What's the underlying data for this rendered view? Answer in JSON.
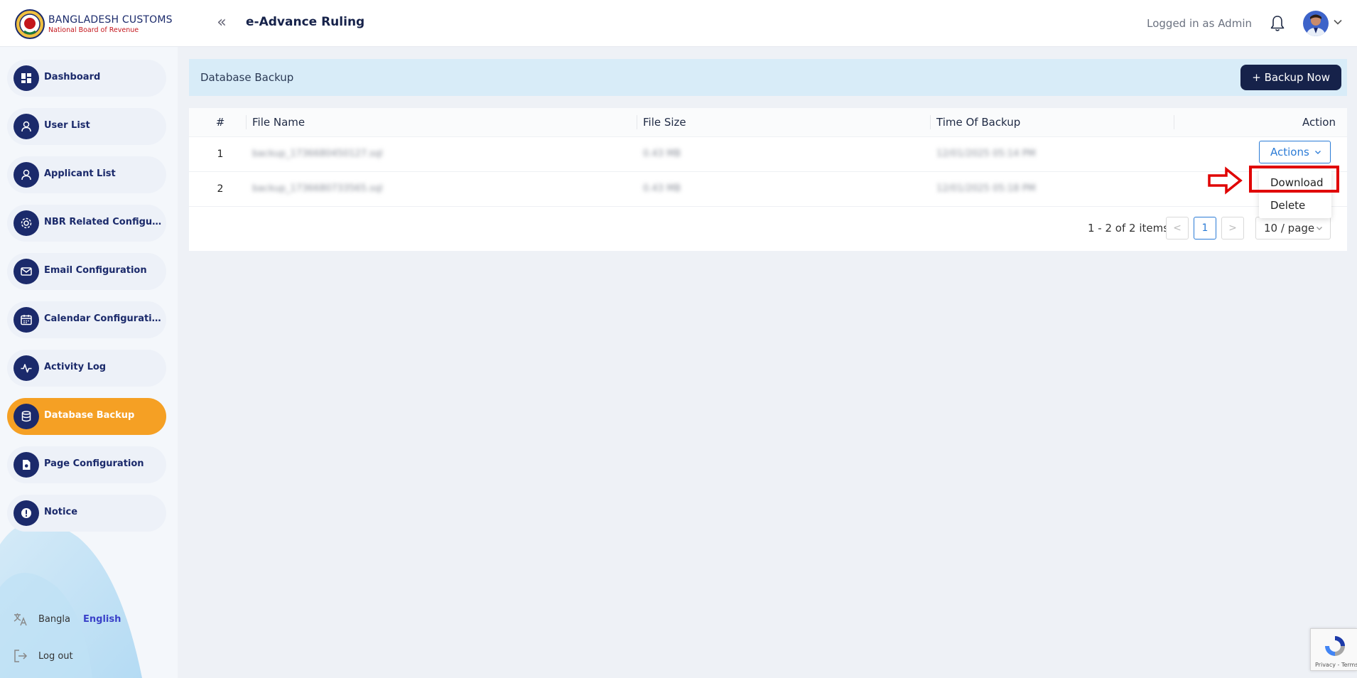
{
  "brand": {
    "title": "BANGLADESH CUSTOMS",
    "subtitle": "National Board of Revenue"
  },
  "header": {
    "app_title": "e-Advance Ruling",
    "logged_in_text": "Logged in as Admin",
    "collapse_icon": "double-chevron-left-icon"
  },
  "sidebar": {
    "items": [
      {
        "label": "Dashboard",
        "icon": "dashboard-icon",
        "active": false
      },
      {
        "label": "User List",
        "icon": "users-icon",
        "active": false
      },
      {
        "label": "Applicant List",
        "icon": "users-icon",
        "active": false
      },
      {
        "label": "NBR Related Configuration",
        "icon": "settings-icon",
        "active": false
      },
      {
        "label": "Email Configuration",
        "icon": "mail-icon",
        "active": false
      },
      {
        "label": "Calendar Configuration",
        "icon": "calendar-icon",
        "active": false
      },
      {
        "label": "Activity Log",
        "icon": "activity-icon",
        "active": false
      },
      {
        "label": "Database Backup",
        "icon": "database-icon",
        "active": true
      },
      {
        "label": "Page Configuration",
        "icon": "file-settings-icon",
        "active": false
      },
      {
        "label": "Notice",
        "icon": "alert-icon",
        "active": false
      }
    ],
    "lang_bangla": "Bangla",
    "lang_english": "English",
    "logout": "Log out"
  },
  "page": {
    "title": "Database Backup",
    "backup_button": "+ Backup Now"
  },
  "table": {
    "headers": [
      "#",
      "File Name",
      "File Size",
      "Time Of Backup",
      "Action"
    ],
    "rows": [
      {
        "index": "1",
        "file_name": "backup_1736680450127.sql",
        "file_size": "0.43 MB",
        "time": "12/01/2025 05:14 PM"
      },
      {
        "index": "2",
        "file_name": "backup_1736680733565.sql",
        "file_size": "0.43 MB",
        "time": "12/01/2025 05:18 PM"
      }
    ],
    "actions_label": "Actions"
  },
  "dropdown": {
    "items": [
      "Download",
      "Delete"
    ]
  },
  "pagination": {
    "summary": "1 - 2 of 2 items",
    "current_page": "1",
    "page_size": "10 / page",
    "prev": "<",
    "next": ">"
  },
  "recaptcha": {
    "text": "Privacy - Terms"
  },
  "colors": {
    "primary_navy": "#1b2a6b",
    "active_orange": "#f5a024",
    "link_blue": "#2b7bd6",
    "annotation_red": "#e00000"
  }
}
